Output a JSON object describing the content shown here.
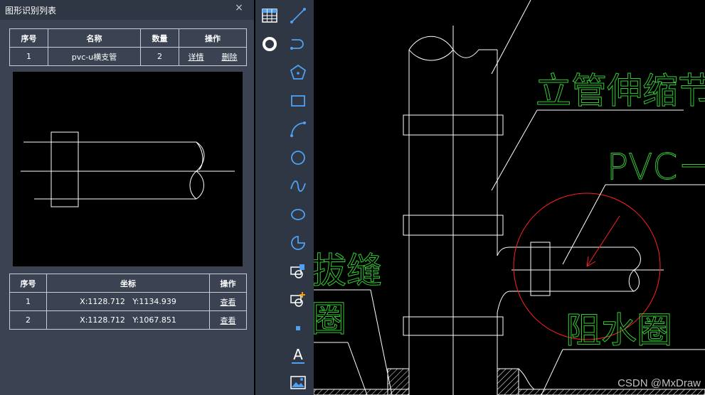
{
  "panel": {
    "title": "图形识别列表",
    "close_glyph": "×"
  },
  "shapes_table": {
    "headers": [
      "序号",
      "名称",
      "数量",
      "操作"
    ],
    "rows": [
      {
        "index": "1",
        "name": "pvc-u横支管",
        "count": "2",
        "detail": "详情",
        "delete": "删除"
      }
    ]
  },
  "coords_table": {
    "headers": [
      "序号",
      "坐标",
      "操作"
    ],
    "rows": [
      {
        "index": "1",
        "coord": "X:1128.712   Y:1134.939",
        "action": "查看"
      },
      {
        "index": "2",
        "coord": "X:1128.712   Y:1067.851",
        "action": "查看"
      }
    ]
  },
  "toolbar": {
    "tools": [
      "table-icon",
      "ring-icon",
      "line-icon",
      "polyline-icon",
      "polygon-icon",
      "rectangle-icon",
      "arc-icon",
      "circle-icon",
      "spline-icon",
      "ellipse-icon",
      "pie-icon",
      "insert-block-icon",
      "add-block-icon",
      "point-icon",
      "text-icon",
      "image-icon"
    ],
    "text_glyph": "A",
    "accent_color": "#4ea1f3"
  },
  "drawing": {
    "labels": {
      "riser_expansion": "立管伸缩节",
      "pvc": "PVC－",
      "seam": "拔缝",
      "ring_left": "圈",
      "water_stop": "阻水圈"
    },
    "label_color": "#33cc33",
    "line_color": "#ffffff",
    "highlight_color": "#ff2020"
  },
  "watermark": "CSDN @MxDraw"
}
